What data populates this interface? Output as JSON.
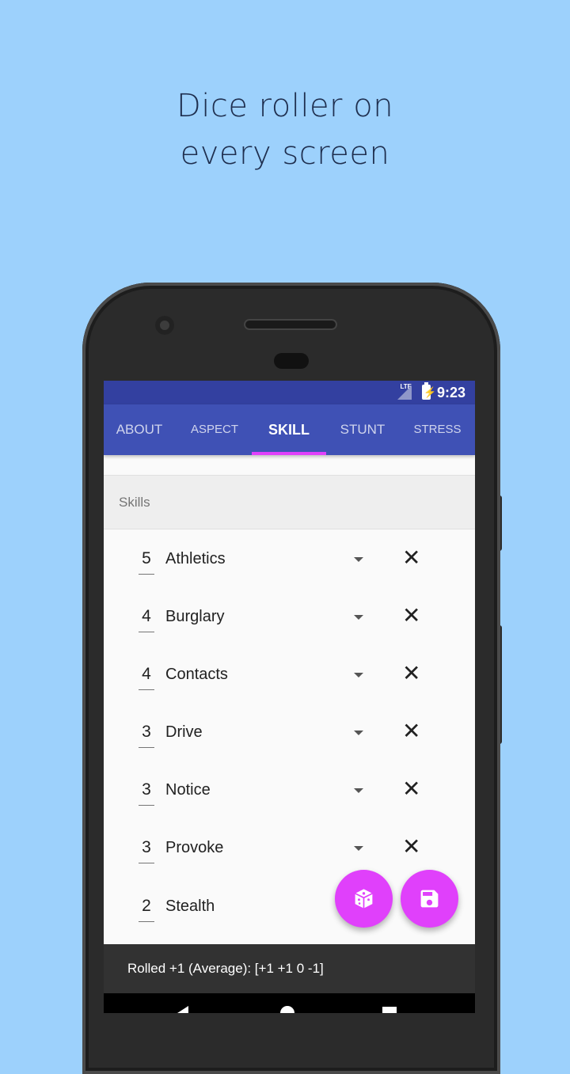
{
  "headline": {
    "line1": "Dice roller on",
    "line2": "every screen"
  },
  "status_bar": {
    "network": "LTE",
    "time": "9:23"
  },
  "tabs": [
    {
      "label": "ABOUT"
    },
    {
      "label": "ASPECT"
    },
    {
      "label": "SKILL"
    },
    {
      "label": "STUNT"
    },
    {
      "label": "STRESS"
    }
  ],
  "active_tab": "SKILL",
  "section": {
    "title": "Skills"
  },
  "skills": [
    {
      "rating": "5",
      "name": "Athletics"
    },
    {
      "rating": "4",
      "name": "Burglary"
    },
    {
      "rating": "4",
      "name": "Contacts"
    },
    {
      "rating": "3",
      "name": "Drive"
    },
    {
      "rating": "3",
      "name": "Notice"
    },
    {
      "rating": "3",
      "name": "Provoke"
    },
    {
      "rating": "2",
      "name": "Stealth"
    }
  ],
  "fabs": {
    "dice": "dice-icon",
    "save": "save-icon"
  },
  "snackbar": {
    "text": "Rolled +1 (Average): [+1 +1 0 -1]"
  },
  "colors": {
    "background": "#9dd1fc",
    "primary": "#3f51b5",
    "primary_dark": "#3340a0",
    "accent": "#e040fb"
  }
}
